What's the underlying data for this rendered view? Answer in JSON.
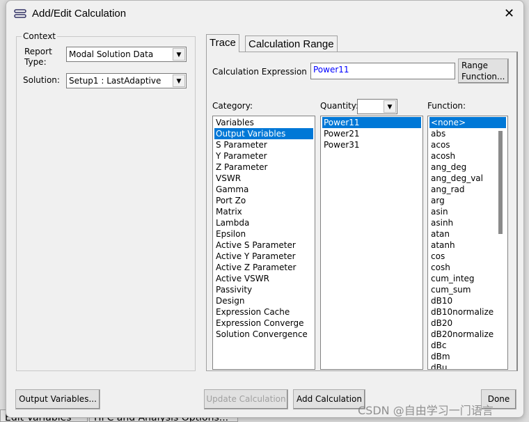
{
  "background": {
    "tabs": [
      "Edit Variables",
      "HFC and Analysis Options..."
    ]
  },
  "dialog": {
    "title": "Add/Edit Calculation",
    "close": "✕"
  },
  "context": {
    "legend": "Context",
    "report_type_label": "Report Type:",
    "report_type_value": "Modal Solution Data",
    "solution_label": "Solution:",
    "solution_value": "Setup1 : LastAdaptive"
  },
  "tabs": [
    {
      "label": "Trace",
      "active": true
    },
    {
      "label": "Calculation Range",
      "active": false
    }
  ],
  "trace": {
    "expr_label": "Calculation Expression :",
    "expr_value": "Power11",
    "expr_color": "#0000ff",
    "range_button": [
      "Range",
      "Function..."
    ],
    "category_label": "Category:",
    "quantity_label": "Quantity:",
    "quantity_combo": "",
    "function_label": "Function:",
    "categories": [
      "Variables",
      "Output Variables",
      "S Parameter",
      "Y Parameter",
      "Z Parameter",
      "VSWR",
      "Gamma",
      "Port Zo",
      "Matrix",
      "Lambda",
      "Epsilon",
      "Active S Parameter",
      "Active Y Parameter",
      "Active Z Parameter",
      "Active VSWR",
      "Passivity",
      "Design",
      "Expression Cache",
      "Expression Converge",
      "Solution Convergence"
    ],
    "category_selected": "Output Variables",
    "quantities": [
      "Power11",
      "Power21",
      "Power31"
    ],
    "quantity_selected": "Power11",
    "functions": [
      "<none>",
      "abs",
      "acos",
      "acosh",
      "ang_deg",
      "ang_deg_val",
      "ang_rad",
      "arg",
      "asin",
      "asinh",
      "atan",
      "atanh",
      "cos",
      "cosh",
      "cum_integ",
      "cum_sum",
      "dB10",
      "dB10normalize",
      "dB20",
      "dB20normalize",
      "dBc",
      "dBm",
      "dBu"
    ],
    "function_selected": "<none>"
  },
  "buttons": {
    "output_variables": "Output Variables...",
    "update": "Update Calculation",
    "add": "Add Calculation",
    "done": "Done"
  },
  "watermark": "CSDN @自由学习一门语言",
  "accent": "#0078d7"
}
